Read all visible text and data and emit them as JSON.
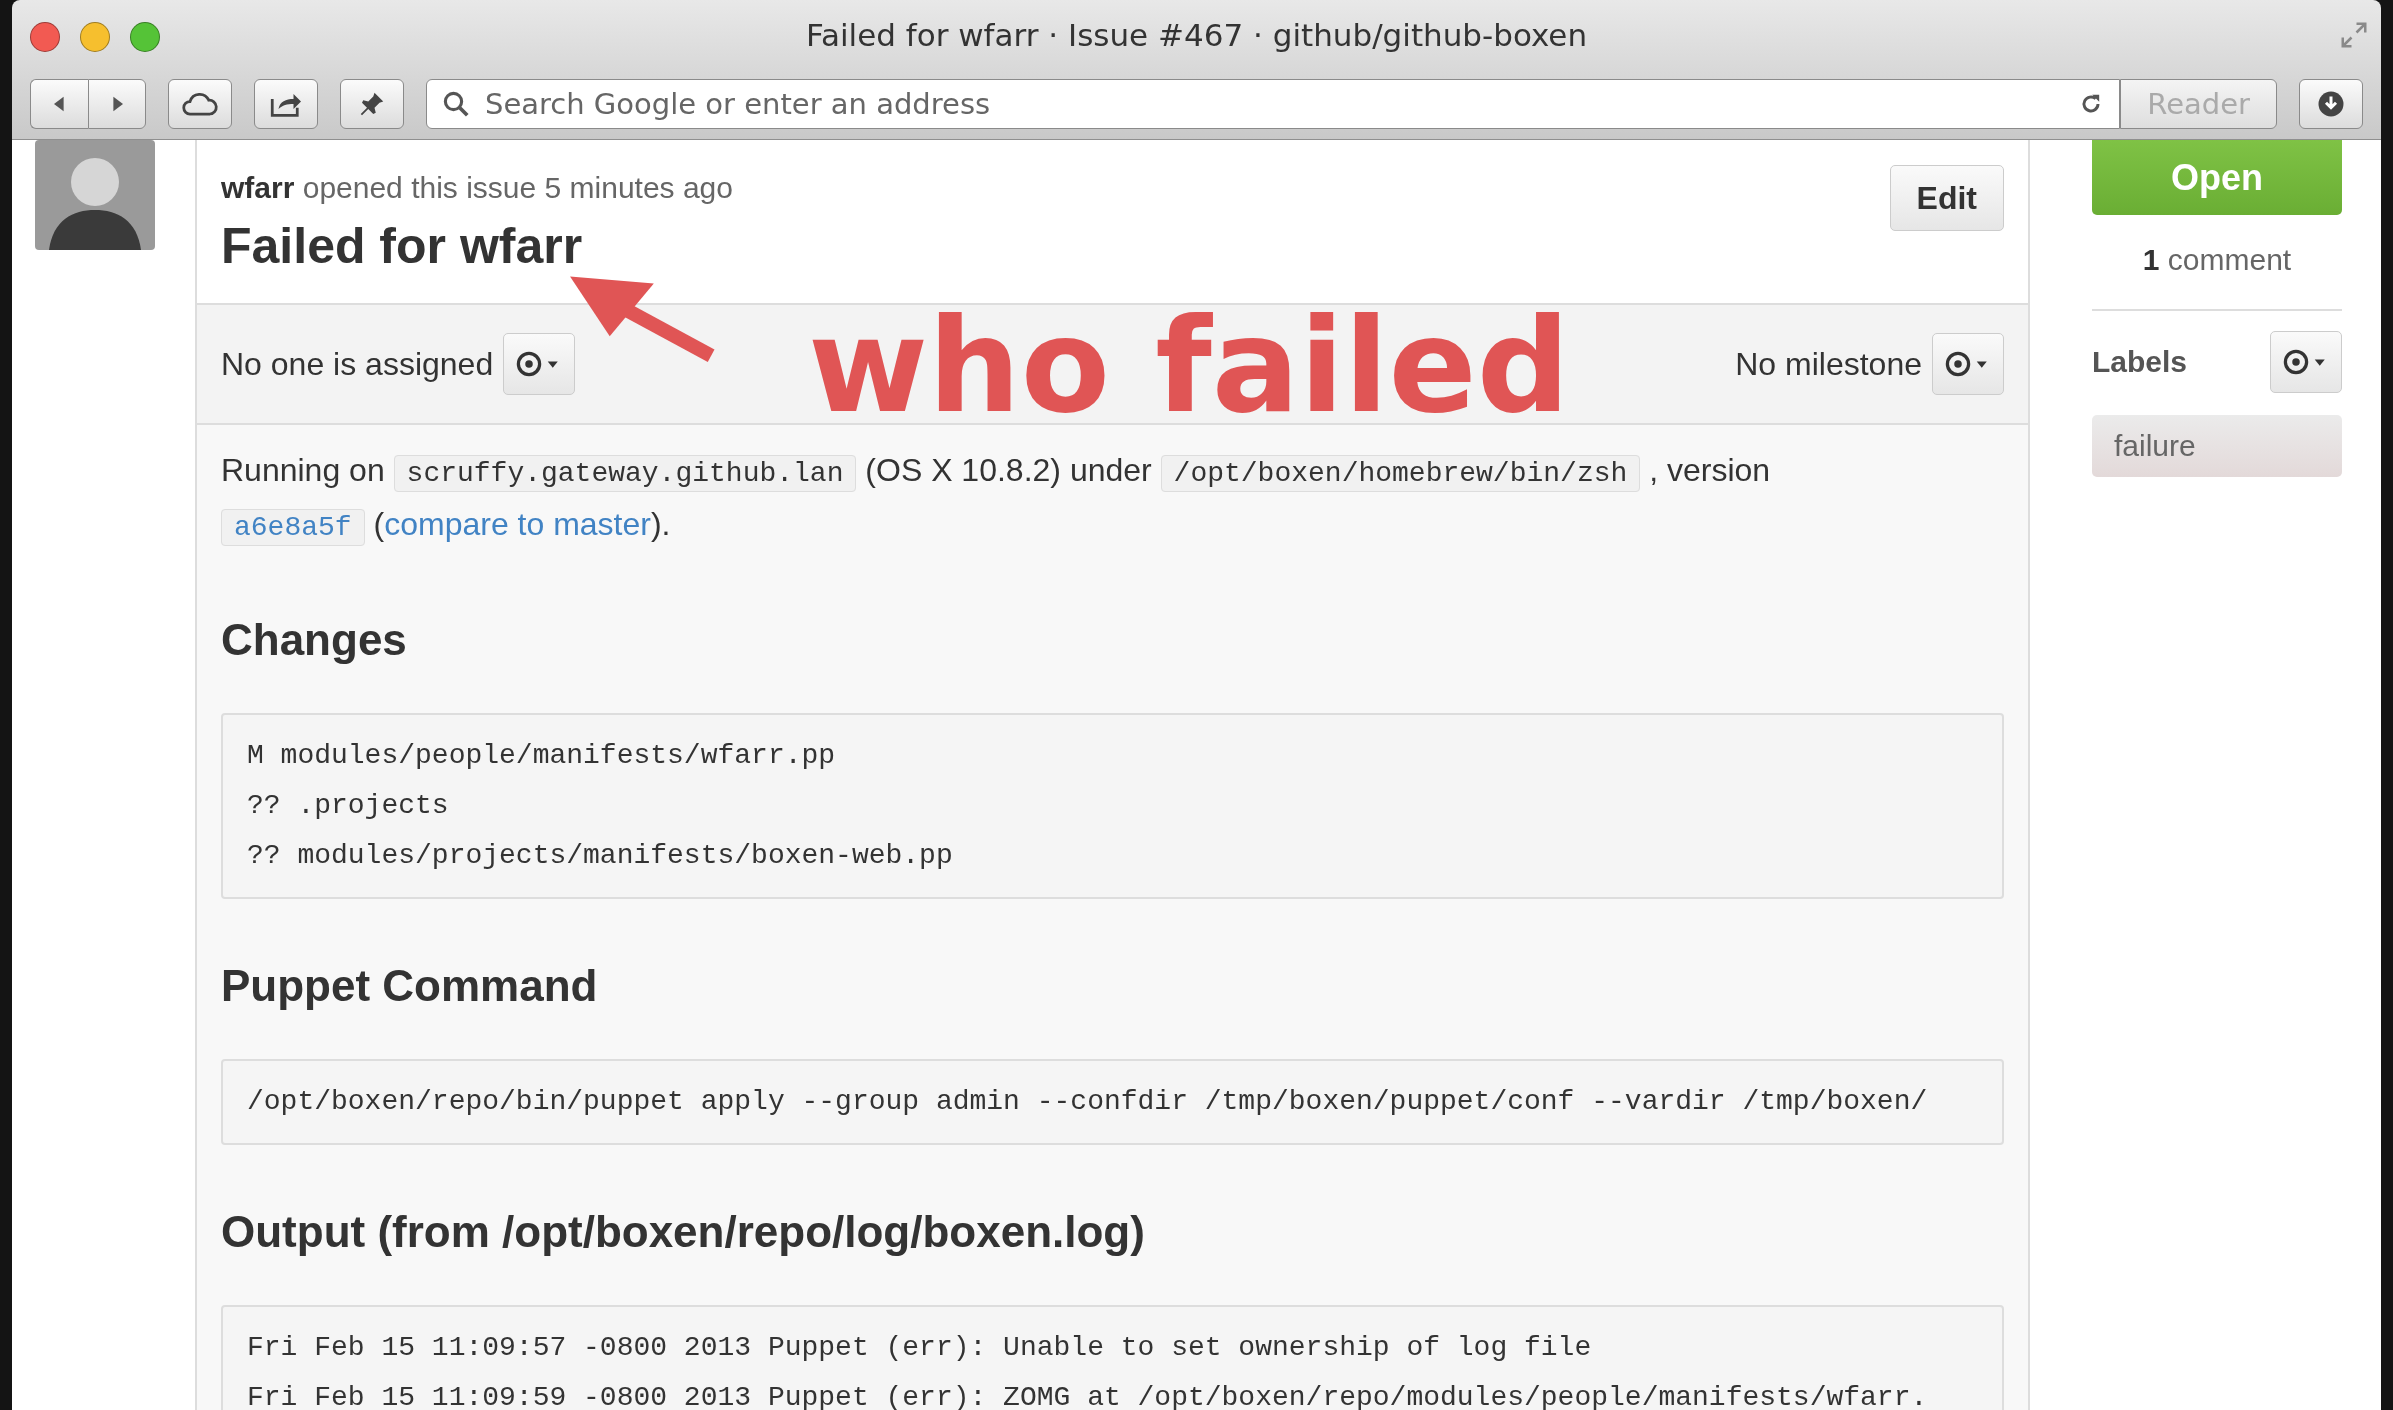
{
  "window": {
    "title": "Failed for wfarr · Issue #467 · github/github-boxen"
  },
  "toolbar": {
    "search_placeholder": "Search Google or enter an address",
    "reader_button": "Reader"
  },
  "issue": {
    "meta": "**wfarr** opened this issue 5 minutes ago",
    "title": "Failed for wfarr",
    "edit_button": "Edit",
    "assignee": "No one is assigned",
    "milestone": "No milestone",
    "description": [
      {
        "kind": "text",
        "text": "Running on "
      },
      {
        "kind": "code",
        "text": "scruffy.gateway.github.lan"
      },
      {
        "kind": "text",
        "text": " (OS X 10.8.2) under "
      },
      {
        "kind": "code",
        "text": "/opt/boxen/homebrew/bin/zsh"
      },
      {
        "kind": "text",
        "text": " , version "
      },
      {
        "kind": "codelink",
        "text": "a6e8a5f"
      },
      {
        "kind": "text",
        "text": " ("
      },
      {
        "kind": "link",
        "text": "compare to master"
      },
      {
        "kind": "text",
        "text": ")."
      }
    ],
    "sections": [
      {
        "heading": "Changes",
        "lines": [
          "M modules/people/manifests/wfarr.pp",
          "?? .projects",
          "?? modules/projects/manifests/boxen-web.pp"
        ]
      },
      {
        "heading": "Puppet Command",
        "lines": [
          "/opt/boxen/repo/bin/puppet apply --group admin --confdir /tmp/boxen/puppet/conf --vardir /tmp/boxen/"
        ]
      },
      {
        "heading": "Output (from /opt/boxen/repo/log/boxen.log)",
        "lines": [
          "Fri Feb 15 11:09:57 -0800 2013 Puppet (err): Unable to set ownership of log file",
          "Fri Feb 15 11:09:59 -0800 2013 Puppet (err): ZOMG at /opt/boxen/repo/modules/people/manifests/wfarr."
        ]
      }
    ]
  },
  "sidebar": {
    "state_button": "Open",
    "comments": "**1** comment",
    "labels_heading": "Labels",
    "labels": [
      "failure"
    ]
  },
  "annotation": {
    "text": "who failed"
  }
}
